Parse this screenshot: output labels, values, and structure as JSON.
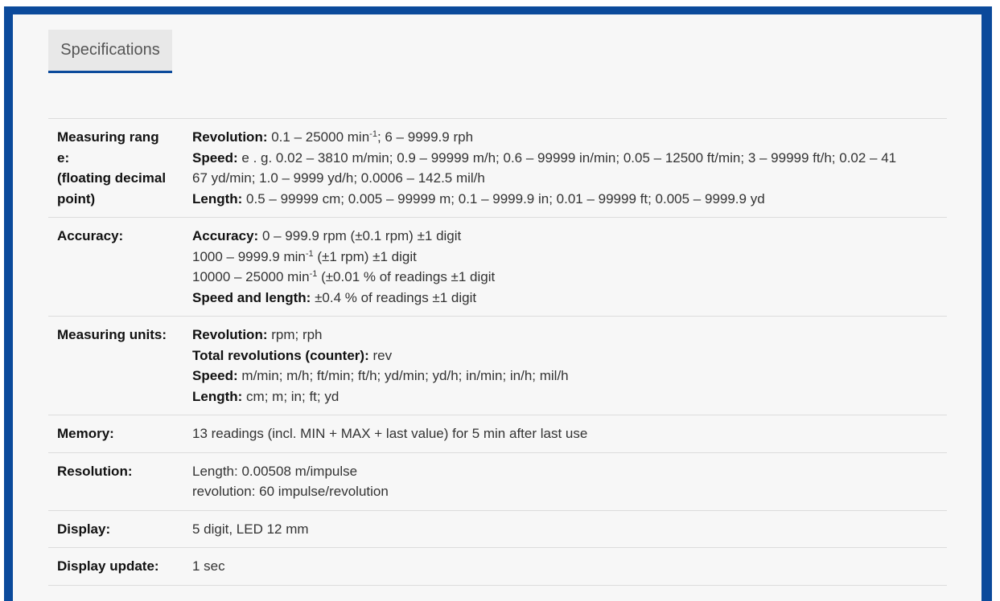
{
  "tab": {
    "label": "Specifications"
  },
  "rows": {
    "measuring_range": {
      "label_line1": "Measuring rang",
      "label_line2": "e:",
      "label_line3": "(floating decimal",
      "label_line4": "point)",
      "revolution_key": "Revolution:",
      "revolution_a": " 0.1 – 25000 min",
      "revolution_sup": "-1",
      "revolution_b": "; 6 – 9999.9 rph",
      "speed_key": "Speed:",
      "speed_val1": " e . g. 0.02 – 3810 m/min; 0.9 – 99999 m/h; 0.6 – 99999 in/min; 0.05 – 12500 ft/min; 3 – 99999 ft/h; 0.02 – 41",
      "speed_val2": "67 yd/min; 1.0 – 9999 yd/h; 0.0006 – 142.5 mil/h",
      "length_key": "Length:",
      "length_val": " 0.5 – 99999 cm; 0.005 – 99999 m; 0.1 – 9999.9 in; 0.01 – 99999 ft; 0.005 – 9999.9 yd"
    },
    "accuracy": {
      "label": "Accuracy:",
      "key1": "Accuracy:",
      "val1": " 0 – 999.9 rpm (±0.1 rpm) ±1 digit",
      "line2_a": "1000 – 9999.9 min",
      "line2_sup": "-1",
      "line2_b": " (±1 rpm) ±1 digit",
      "line3_a": "10000 – 25000 min",
      "line3_sup": "-1",
      "line3_b": " (±0.01 % of readings ±1 digit",
      "key4": "Speed and length:",
      "val4": " ±0.4 % of readings ±1 digit"
    },
    "units": {
      "label": "Measuring units:",
      "key1": "Revolution:",
      "val1": " rpm; rph",
      "key2": "Total revolutions (counter):",
      "val2": " rev",
      "key3": "Speed:",
      "val3": " m/min; m/h; ft/min; ft/h; yd/min; yd/h; in/min; in/h; mil/h",
      "key4": "Length:",
      "val4": " cm; m; in; ft; yd"
    },
    "memory": {
      "label": "Memory:",
      "value": "13 readings (incl. MIN + MAX + last value) for 5 min after last use"
    },
    "resolution": {
      "label": "Resolution:",
      "line1": "Length: 0.00508 m/impulse",
      "line2": "revolution: 60 impulse/revolution"
    },
    "display": {
      "label": "Display:",
      "value": "5 digit, LED 12 mm"
    },
    "display_update": {
      "label": "Display update:",
      "value": "1 sec"
    }
  },
  "colors": {
    "frame": "#0b4a9b",
    "panel": "#f7f7f7",
    "tab_bg": "#e8e8e8"
  }
}
